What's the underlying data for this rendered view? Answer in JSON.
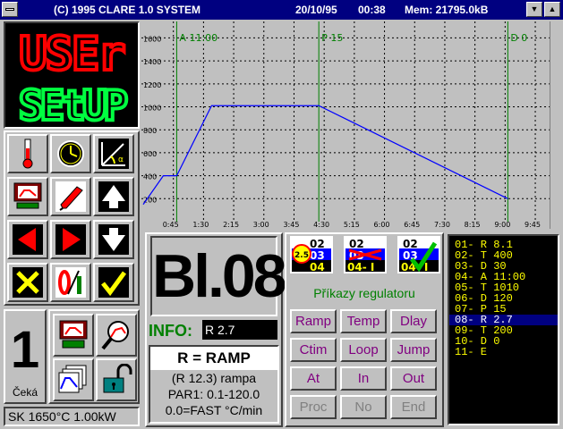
{
  "window": {
    "title": "(C) 1995 CLARE 1.0 SYSTEM",
    "date": "20/10/95",
    "time": "00:38",
    "mem": "Mem: 21795.0kB"
  },
  "mode_display": {
    "line1": "USEr",
    "line2": "SEtUP"
  },
  "chart_data": {
    "type": "line",
    "y_ticks": [
      "1600",
      "1400",
      "1200",
      "1000",
      "800",
      "600",
      "400",
      "200"
    ],
    "x_ticks": [
      "0:45",
      "1:30",
      "2:15",
      "3:00",
      "3:45",
      "4:30",
      "5:15",
      "6:00",
      "6:45",
      "7:30",
      "8:15",
      "9:00",
      "9:45"
    ],
    "ylim": [
      0,
      1650
    ],
    "x_hours": [
      0,
      0.5,
      0.833,
      1.7,
      4.367,
      9.067
    ],
    "y": [
      150,
      400,
      400,
      1010,
      1010,
      200
    ],
    "markers": [
      {
        "label": "A 11:00",
        "x": 0.833
      },
      {
        "label": "P 15",
        "x": 4.367
      },
      {
        "label": "D 0",
        "x": 9.067
      }
    ],
    "line_color": "#0000ff",
    "marker_color": "#008000"
  },
  "status": {
    "step_number": "1",
    "step_state": "Čeká",
    "furnace": "SK 1650°C 1.00kW"
  },
  "block": {
    "label": "Bl.08"
  },
  "info": {
    "label": "INFO:",
    "value": "R 2.7",
    "heading": "R = RAMP",
    "line1": "(R 12.3) rampa",
    "line2": "PAR1: 0.1-120.0",
    "line3": "0.0=FAST °C/min"
  },
  "commands": {
    "title": "Příkazy regulatoru",
    "rows": [
      [
        "Ramp",
        "Temp",
        "Dlay"
      ],
      [
        "Ctim",
        "Loop",
        "Jump"
      ],
      [
        "At",
        "In",
        "Out"
      ],
      [
        "Proc",
        "No",
        "End"
      ]
    ]
  },
  "program": {
    "lines": [
      "01- R 8.1",
      "02- T 400",
      "03- D 30",
      "04- A 11:00",
      "05- T 1010",
      "06- D 120",
      "07- P 15",
      "08- R 2.7",
      "09- T 200",
      "10- D 0",
      "11- E"
    ],
    "selected": 7
  },
  "mini_icons": [
    {
      "a": "02",
      "b": "03",
      "c": "04",
      "badge": "2.5"
    },
    {
      "a": "02",
      "b": "03",
      "c": "04- I"
    },
    {
      "a": "02",
      "b": "03",
      "c": "04- I"
    }
  ],
  "colors": {
    "led_red": "#ff0000",
    "led_green": "#00ff40",
    "cmd_active": "#800080",
    "cmd_disabled": "#808080"
  }
}
